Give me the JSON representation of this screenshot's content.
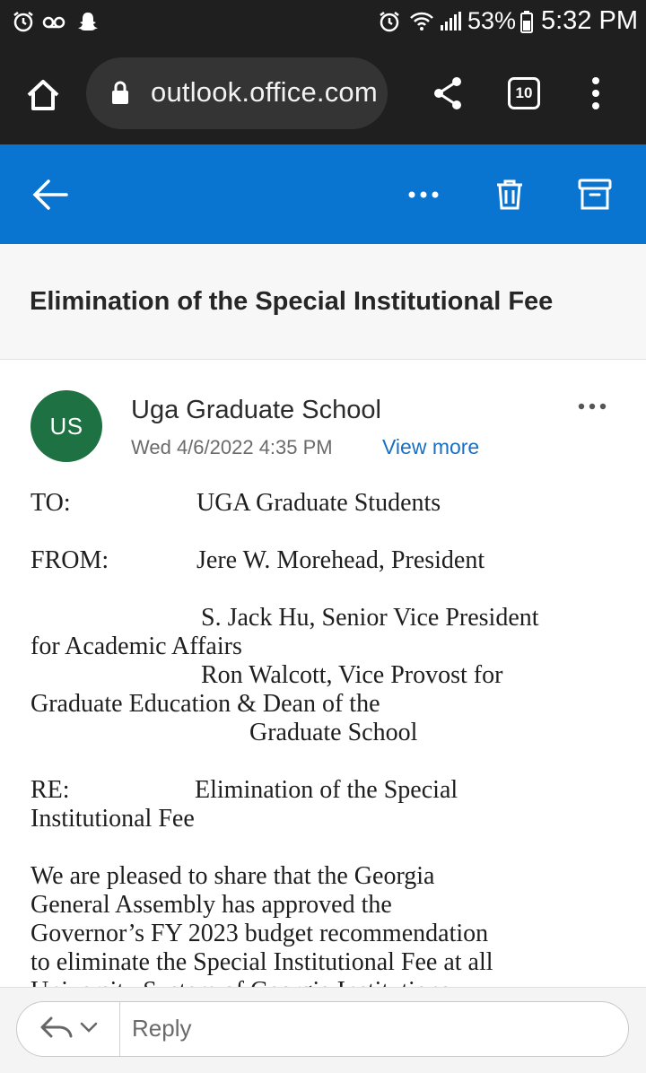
{
  "status_bar": {
    "battery_percent": "53%",
    "time": "5:32 PM"
  },
  "browser": {
    "url": "outlook.office.com",
    "tab_count": "10"
  },
  "message": {
    "subject": "Elimination of the Special Institutional Fee",
    "avatar_initials": "US",
    "sender": "Uga Graduate School",
    "date": "Wed 4/6/2022 4:35 PM",
    "view_more_label": "View more",
    "memo": {
      "to_label": "TO:",
      "to_value": "UGA Graduate Students",
      "from_label": "FROM:",
      "from_value": "Jere W. Morehead, President",
      "from_line2a": "S. Jack Hu, Senior Vice President",
      "from_line2b": "for Academic Affairs",
      "from_line3a": "Ron Walcott, Vice Provost for",
      "from_line3b": "Graduate Education & Dean of the",
      "from_line3c": "Graduate School",
      "re_label": "RE:",
      "re_value": "Elimination of the Special",
      "re_value_cont": "Institutional Fee"
    },
    "body_lines": [
      "We are pleased to share that the Georgia",
      "General Assembly has approved the",
      "Governor’s FY 2023 budget recommendation",
      "to eliminate the Special Institutional Fee at all",
      "University System of Georgia Institutions"
    ]
  },
  "reply": {
    "placeholder": "Reply"
  },
  "colors": {
    "header_blue": "#0a74d1",
    "avatar_green": "#1d7143",
    "link_blue": "#1a6fc3"
  }
}
